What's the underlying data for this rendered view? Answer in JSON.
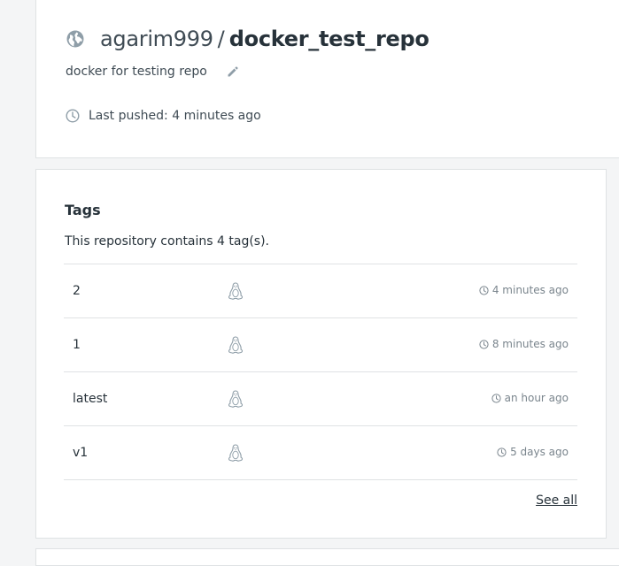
{
  "repo": {
    "owner": "agarim999",
    "separator": "/",
    "name": "docker_test_repo",
    "description": "docker for testing repo",
    "last_pushed": "Last pushed: 4 minutes ago",
    "visibility_icon": "globe-icon"
  },
  "tags_section": {
    "title": "Tags",
    "count_text": "This repository contains 4 tag(s).",
    "see_all_label": "See all",
    "rows": [
      {
        "name": "2",
        "os_icon": "linux-tux-icon",
        "time": "4 minutes ago"
      },
      {
        "name": "1",
        "os_icon": "linux-tux-icon",
        "time": "8 minutes ago"
      },
      {
        "name": "latest",
        "os_icon": "linux-tux-icon",
        "time": "an hour ago"
      },
      {
        "name": "v1",
        "os_icon": "linux-tux-icon",
        "time": "5 days ago"
      }
    ]
  },
  "colors": {
    "background": "#f4f5f6",
    "card": "#ffffff",
    "border": "#dfe2e4",
    "text_primary": "#27323a",
    "text_secondary": "#7a858d",
    "icon": "#8f9ea8"
  }
}
